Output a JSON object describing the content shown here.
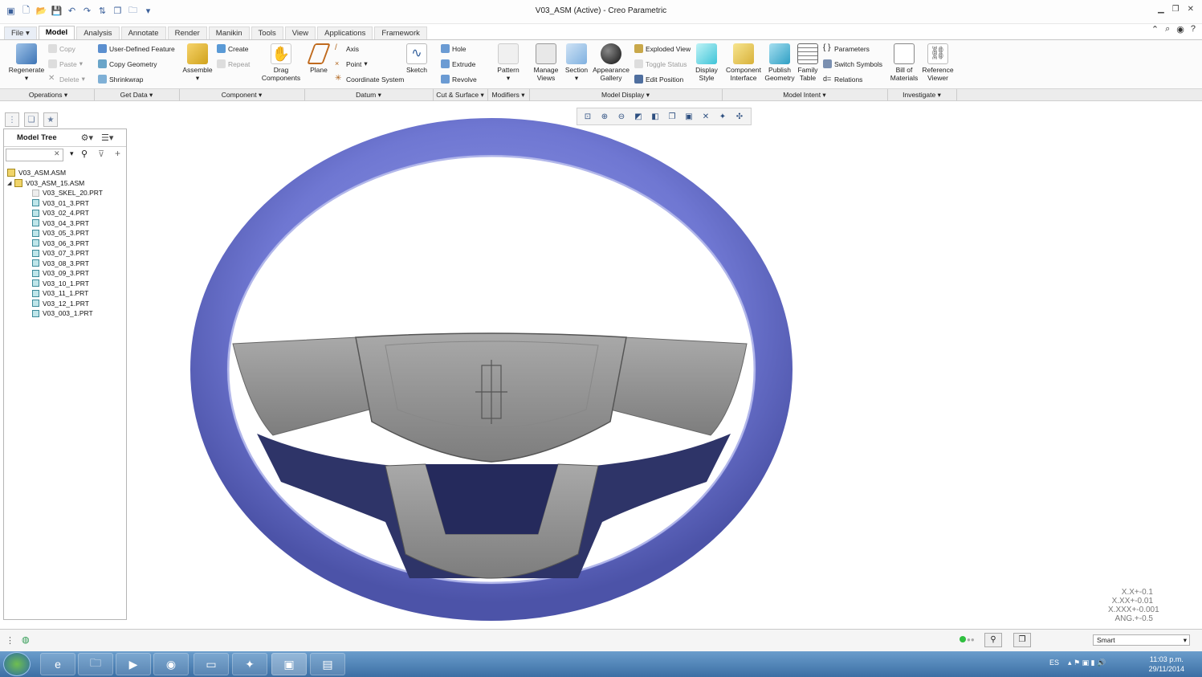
{
  "window": {
    "title": "V03_ASM (Active) - Creo Parametric"
  },
  "tabs": [
    "File",
    "Model",
    "Analysis",
    "Annotate",
    "Render",
    "Manikin",
    "Tools",
    "View",
    "Applications",
    "Framework"
  ],
  "ribbon": {
    "regenerate": "Regenerate",
    "copy": "Copy",
    "paste": "Paste",
    "delete": "Delete",
    "udf": "User-Defined Feature",
    "copy_geometry": "Copy Geometry",
    "shrinkwrap": "Shrinkwrap",
    "assemble": "Assemble",
    "create": "Create",
    "repeat": "Repeat",
    "drag_1": "Drag",
    "drag_2": "Components",
    "plane": "Plane",
    "axis": "Axis",
    "point": "Point",
    "coordinate_system": "Coordinate System",
    "sketch": "Sketch",
    "hole": "Hole",
    "extrude": "Extrude",
    "revolve": "Revolve",
    "pattern": "Pattern",
    "manage_views_1": "Manage",
    "manage_views_2": "Views",
    "section": "Section",
    "appearance_1": "Appearance",
    "appearance_2": "Gallery",
    "exploded_view": "Exploded View",
    "toggle_status": "Toggle Status",
    "edit_position": "Edit Position",
    "display_style_1": "Display",
    "display_style_2": "Style",
    "component_interface_1": "Component",
    "component_interface_2": "Interface",
    "publish_geometry_1": "Publish",
    "publish_geometry_2": "Geometry",
    "family_table_1": "Family",
    "family_table_2": "Table",
    "parameters": "Parameters",
    "switch_symbols": "Switch Symbols",
    "relations": "Relations",
    "bom_1": "Bill of",
    "bom_2": "Materials",
    "reference_viewer_1": "Reference",
    "reference_viewer_2": "Viewer"
  },
  "groups": [
    "Operations",
    "Get Data",
    "Component",
    "Datum",
    "Cut & Surface",
    "Modifiers",
    "Model Display",
    "Model Intent",
    "Investigate"
  ],
  "tree": {
    "header": "Model Tree",
    "items": [
      "V03_ASM.ASM",
      "V03_ASM_15.ASM",
      "V03_SKEL_20.PRT",
      "V03_01_3.PRT",
      "V03_02_4.PRT",
      "V03_04_3.PRT",
      "V03_05_3.PRT",
      "V03_06_3.PRT",
      "V03_07_3.PRT",
      "V03_08_3.PRT",
      "V03_09_3.PRT",
      "V03_10_1.PRT",
      "V03_11_1.PRT",
      "V03_12_1.PRT",
      "V03_003_1.PRT"
    ]
  },
  "tolerance": [
    "X.X+-0.1",
    "X.XX+-0.01",
    "X.XXX+-0.001",
    "ANG.+-0.5"
  ],
  "status": {
    "filter": "Smart"
  },
  "taskbar": {
    "lang": "ES",
    "time": "11:03 p.m.",
    "date": "29/11/2014"
  },
  "colors": {
    "wheel": "#6f77d2",
    "hub": "#8e8e8e",
    "accent": "#3a5f9a"
  }
}
